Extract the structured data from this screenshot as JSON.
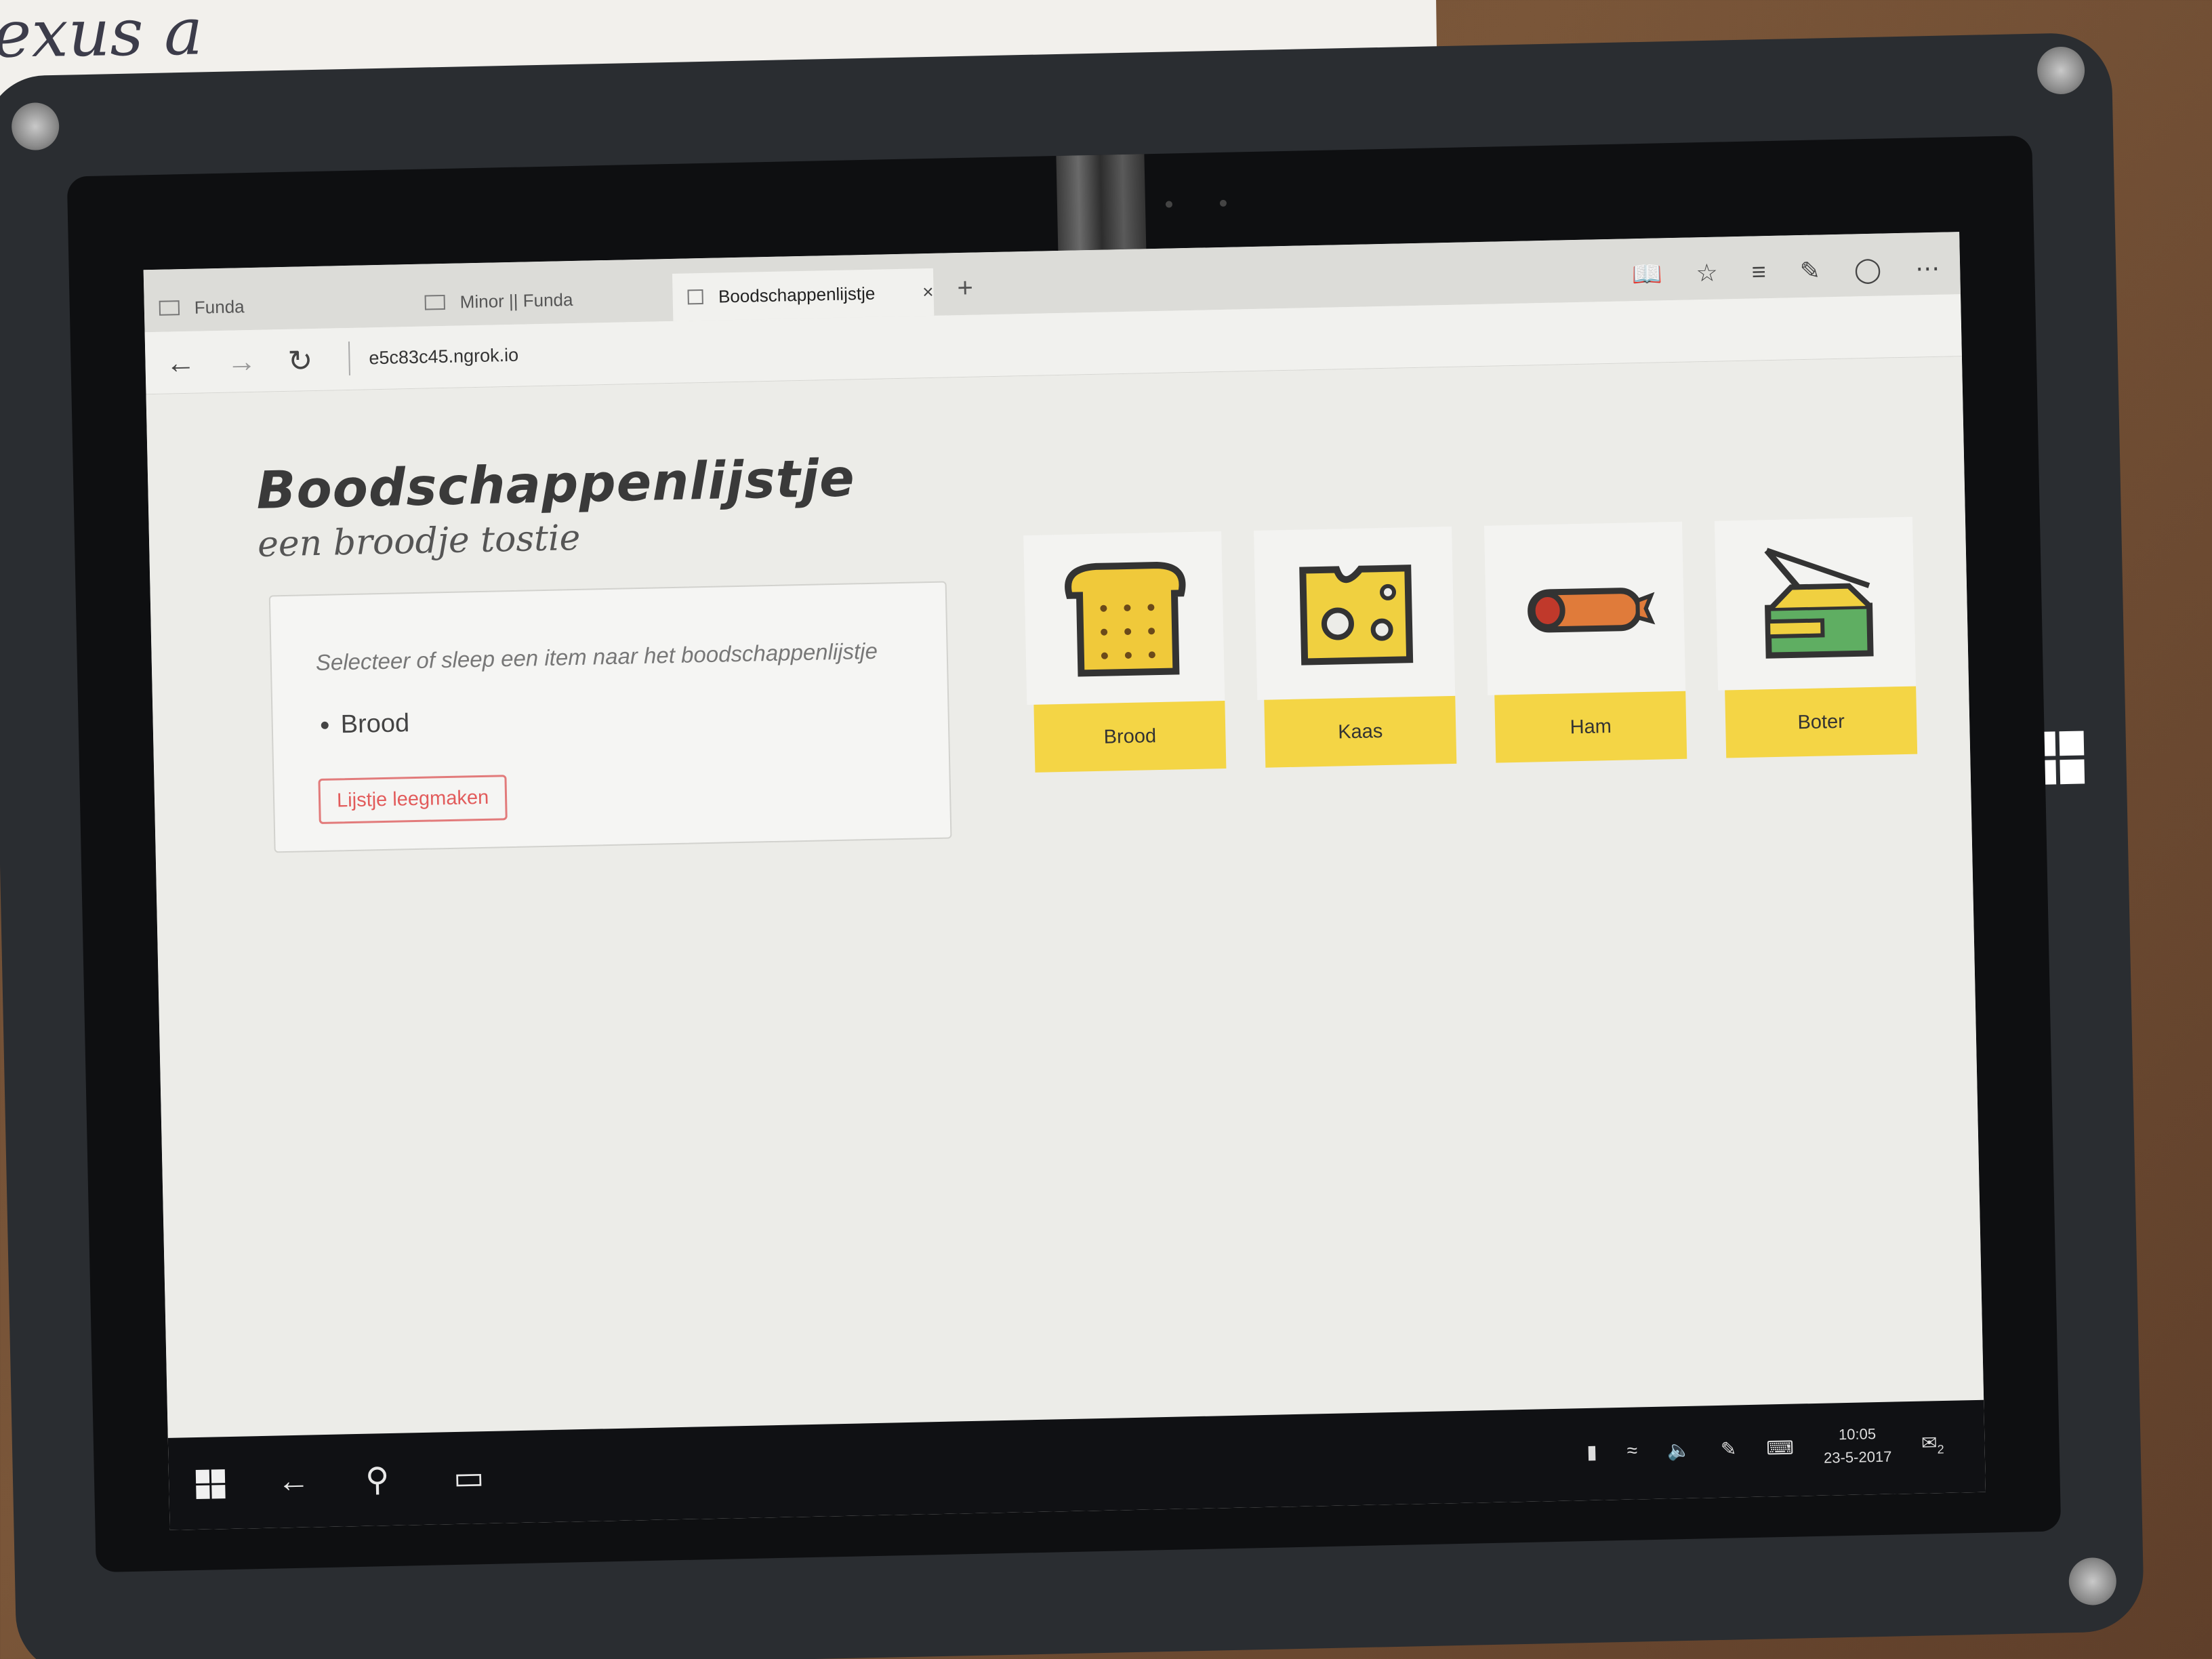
{
  "paper": {
    "scribble": "exus a"
  },
  "browser": {
    "tabs": [
      {
        "label": "Funda",
        "active": false
      },
      {
        "label": "Minor || Funda",
        "active": false
      },
      {
        "label": "Boodschappenlijstje",
        "active": true
      }
    ],
    "new_tab_label": "+",
    "close_label": "×",
    "url": "e5c83c45.ngrok.io",
    "icons": [
      "reading-view-icon",
      "favorite-star-icon",
      "hub-icon",
      "web-note-icon",
      "share-icon",
      "more-icon"
    ]
  },
  "page": {
    "title": "Boodschappenlijstje",
    "subtitle": "een broodje tostie",
    "list_hint": "Selecteer of sleep een item naar het boodschappenlijstje",
    "list_items": [
      "Brood"
    ],
    "clear_button": "Lijstje leegmaken",
    "products": [
      {
        "label": "Brood",
        "icon": "bread-icon"
      },
      {
        "label": "Kaas",
        "icon": "cheese-icon"
      },
      {
        "label": "Ham",
        "icon": "sausage-icon"
      },
      {
        "label": "Boter",
        "icon": "butter-tin-icon"
      }
    ],
    "colors": {
      "accent": "#f4d545",
      "danger": "#e25b5b"
    }
  },
  "taskbar": {
    "time": "10:05",
    "date": "23-5-2017",
    "notification_count": "2"
  }
}
